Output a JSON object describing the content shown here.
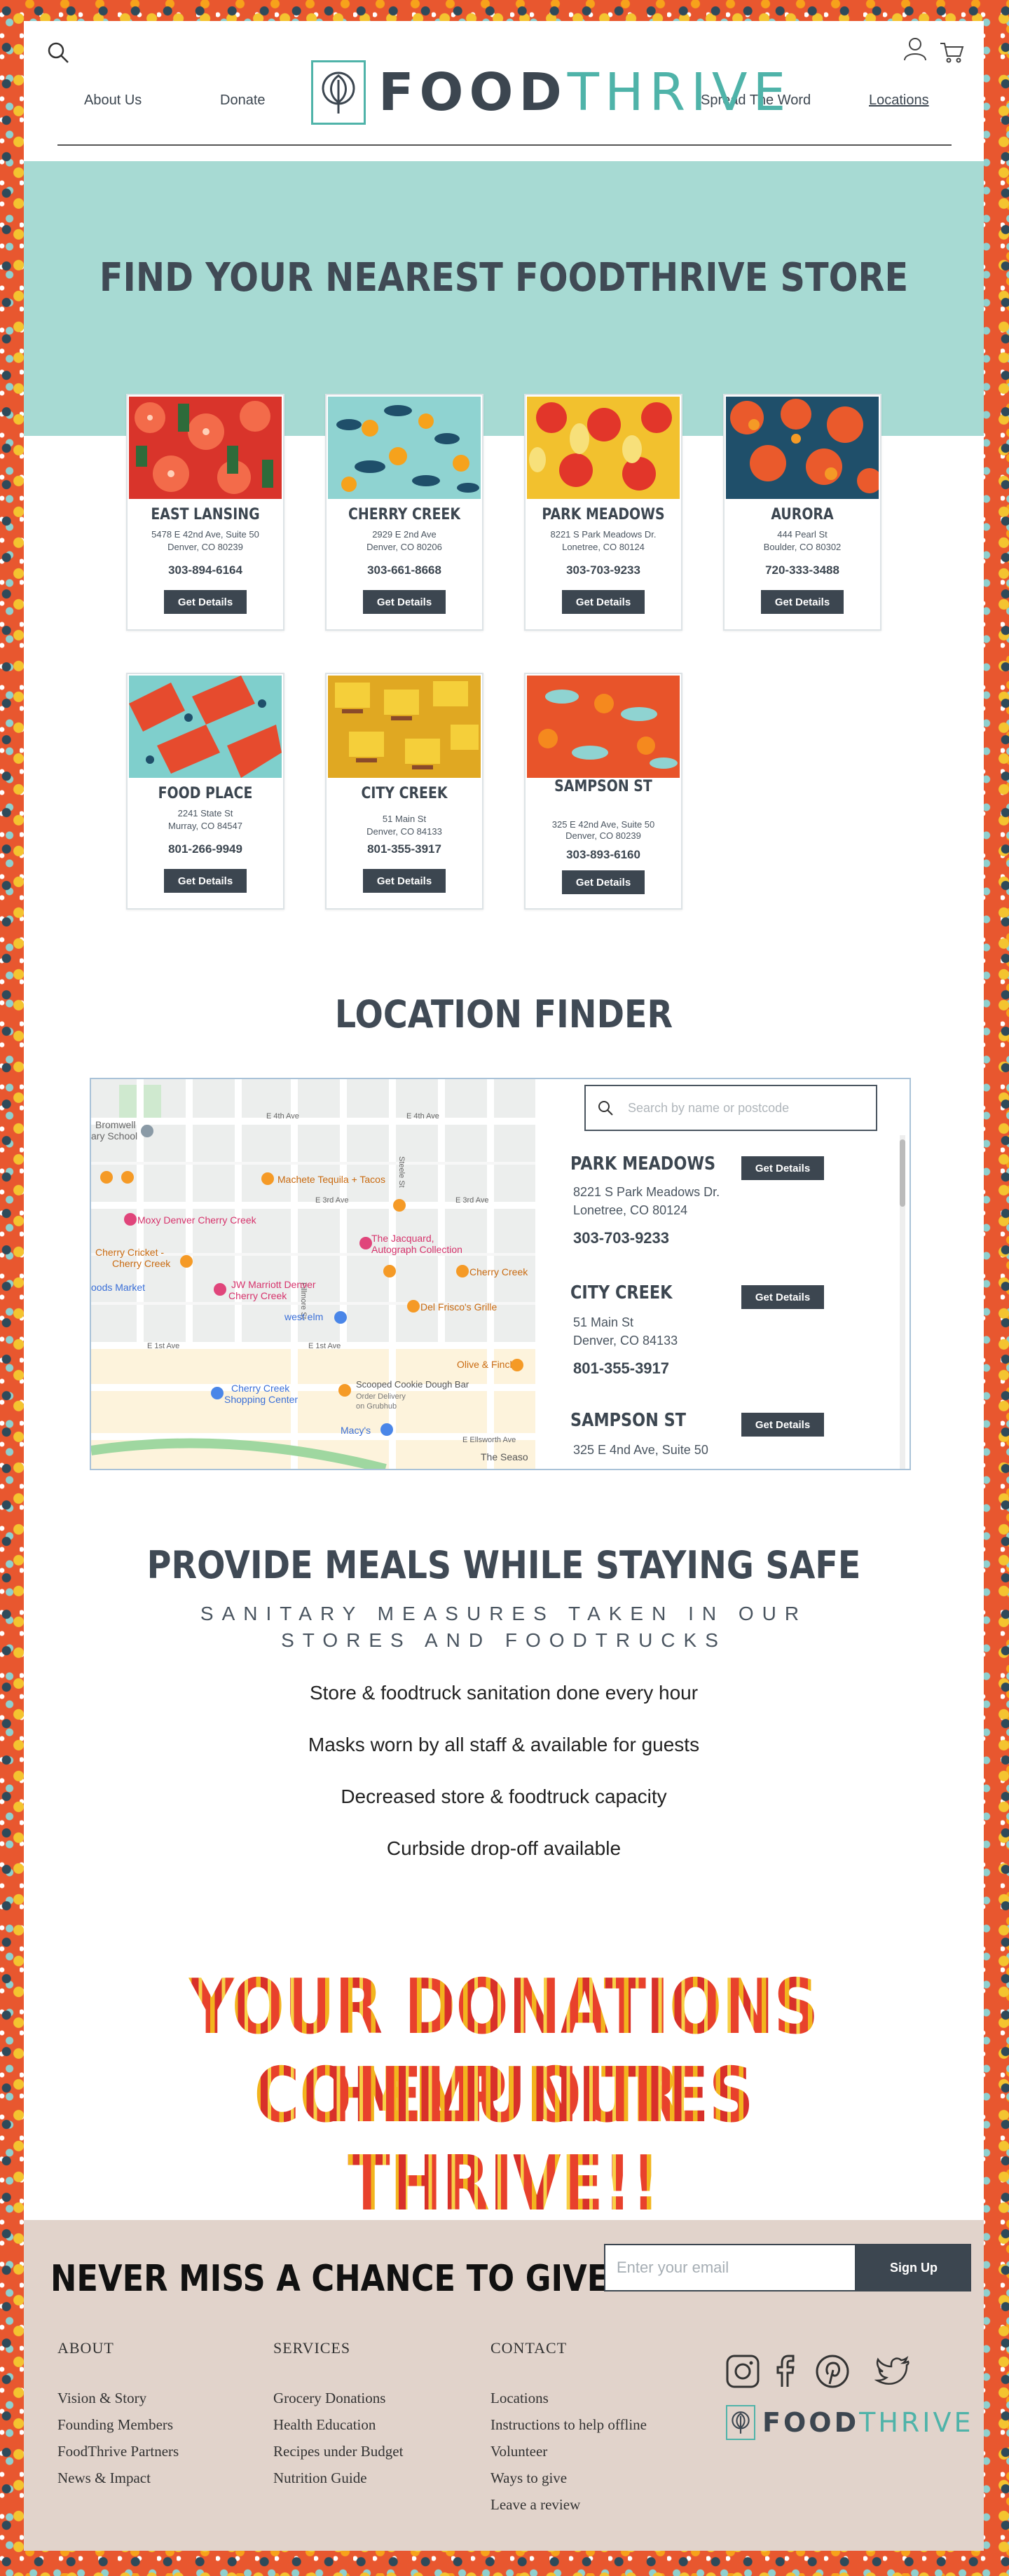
{
  "header": {
    "nav": {
      "about": "About Us",
      "donate": "Donate",
      "spread": "Spread The Word",
      "locations": "Locations"
    },
    "logo": {
      "part1": "FOOD",
      "part2": "THRIVE"
    }
  },
  "hero": {
    "title": "FIND YOUR NEAREST FOODTHRIVE STORE"
  },
  "stores": [
    {
      "name": "EAST LANSING",
      "addr1": "5478 E 42nd Ave, Suite 50",
      "addr2": "Denver, CO 80239",
      "phone": "303-894-6164",
      "button": "Get Details"
    },
    {
      "name": "CHERRY CREEK",
      "addr1": "2929 E 2nd Ave",
      "addr2": "Denver, CO 80206",
      "phone": "303-661-8668",
      "button": "Get Details"
    },
    {
      "name": "PARK MEADOWS",
      "addr1": "8221 S Park Meadows Dr.",
      "addr2": "Lonetree, CO 80124",
      "phone": "303-703-9233",
      "button": "Get Details"
    },
    {
      "name": "AURORA",
      "addr1": "444 Pearl St",
      "addr2": "Boulder, CO 80302",
      "phone": "720-333-3488",
      "button": "Get Details"
    },
    {
      "name": "FOOD PLACE",
      "addr1": "2241 State St",
      "addr2": "Murray, CO 84547",
      "phone": "801-266-9949",
      "button": "Get Details"
    },
    {
      "name": "CITY CREEK",
      "addr1": "51 Main St",
      "addr2": "Denver, CO 84133",
      "phone": "801-355-3917",
      "button": "Get Details"
    },
    {
      "name": "SAMPSON ST",
      "addr1": "325 E 42nd Ave, Suite 50",
      "addr2": "Denver, CO 80239",
      "phone": "303-893-6160",
      "button": "Get Details"
    }
  ],
  "finder": {
    "title": "LOCATION FINDER",
    "search_placeholder": "Search by name or postcode",
    "results": [
      {
        "name": "PARK MEADOWS",
        "addr1": "8221 S Park Meadows Dr.",
        "addr2": "Lonetree, CO 80124",
        "phone": "303-703-9233",
        "button": "Get Details"
      },
      {
        "name": "CITY CREEK",
        "addr1": "51 Main St",
        "addr2": "Denver, CO 84133",
        "phone": "801-355-3917",
        "button": "Get Details"
      },
      {
        "name": "SAMPSON ST",
        "addr1": "325 E 4nd Ave, Suite 50",
        "button": "Get Details"
      }
    ],
    "map": {
      "streets": [
        "E 4th Ave",
        "E 4th Ave",
        "E 3rd Ave",
        "E 3rd Ave",
        "E 1st Ave",
        "E 1st Ave",
        "E Ellsworth Ave",
        "Fillmore St",
        "Steele St"
      ],
      "places": [
        "Bromwell",
        "ary School",
        "Machete Tequila + Tacos",
        "Moxy Denver Cherry Creek",
        "Cherry Cricket -",
        "Cherry Creek",
        "The Jacquard,",
        "Autograph Collection",
        "Cherry Creek",
        "JW Marriott Denver",
        "Cherry Creek",
        "oods Market",
        "west elm",
        "Del Frisco's Grille",
        "Olive & Finch",
        "Cherry Creek",
        "Shopping Center",
        "Scooped Cookie Dough Bar",
        "Order Delivery",
        "on Grubhub",
        "Macy's",
        "The Seaso"
      ]
    }
  },
  "safety": {
    "title": "PROVIDE MEALS WHILE STAYING SAFE",
    "subtitle": "SANITARY MEASURES TAKEN IN OUR STORES AND FOODTRUCKS",
    "items": [
      "Store & foodtruck sanitation done every hour",
      "Masks worn by all staff & available for guests",
      "Decreased store & foodtruck capacity",
      "Curbside drop-off available"
    ]
  },
  "banner": {
    "line1": "YOUR DONATIONS HELP OUR",
    "line2": "COMMUNITIES THRIVE!!"
  },
  "footer": {
    "cta": "NEVER MISS A CHANCE TO GIVE",
    "email_placeholder": "Enter your email",
    "signup": "Sign Up",
    "columns": [
      {
        "heading": "ABOUT",
        "links": [
          "Vision & Story",
          "Founding Members",
          "FoodThrive Partners",
          "News & Impact"
        ]
      },
      {
        "heading": "SERVICES",
        "links": [
          "Grocery Donations",
          "Health Education",
          "Recipes under Budget",
          "Nutrition Guide"
        ]
      },
      {
        "heading": "CONTACT",
        "links": [
          "Locations",
          "Instructions to help offline",
          "Volunteer",
          "Ways to give",
          "Leave a review"
        ]
      }
    ],
    "logo": {
      "part1": "FOOD",
      "part2": "THRIVE"
    }
  },
  "colors": {
    "teal": "#4fb3a9",
    "hero_bg": "#a7dad3",
    "dark": "#3c4650",
    "footer_bg": "#e1d3cb",
    "banner_red": "#e63a2a",
    "banner_yellow": "#f2b51e"
  }
}
